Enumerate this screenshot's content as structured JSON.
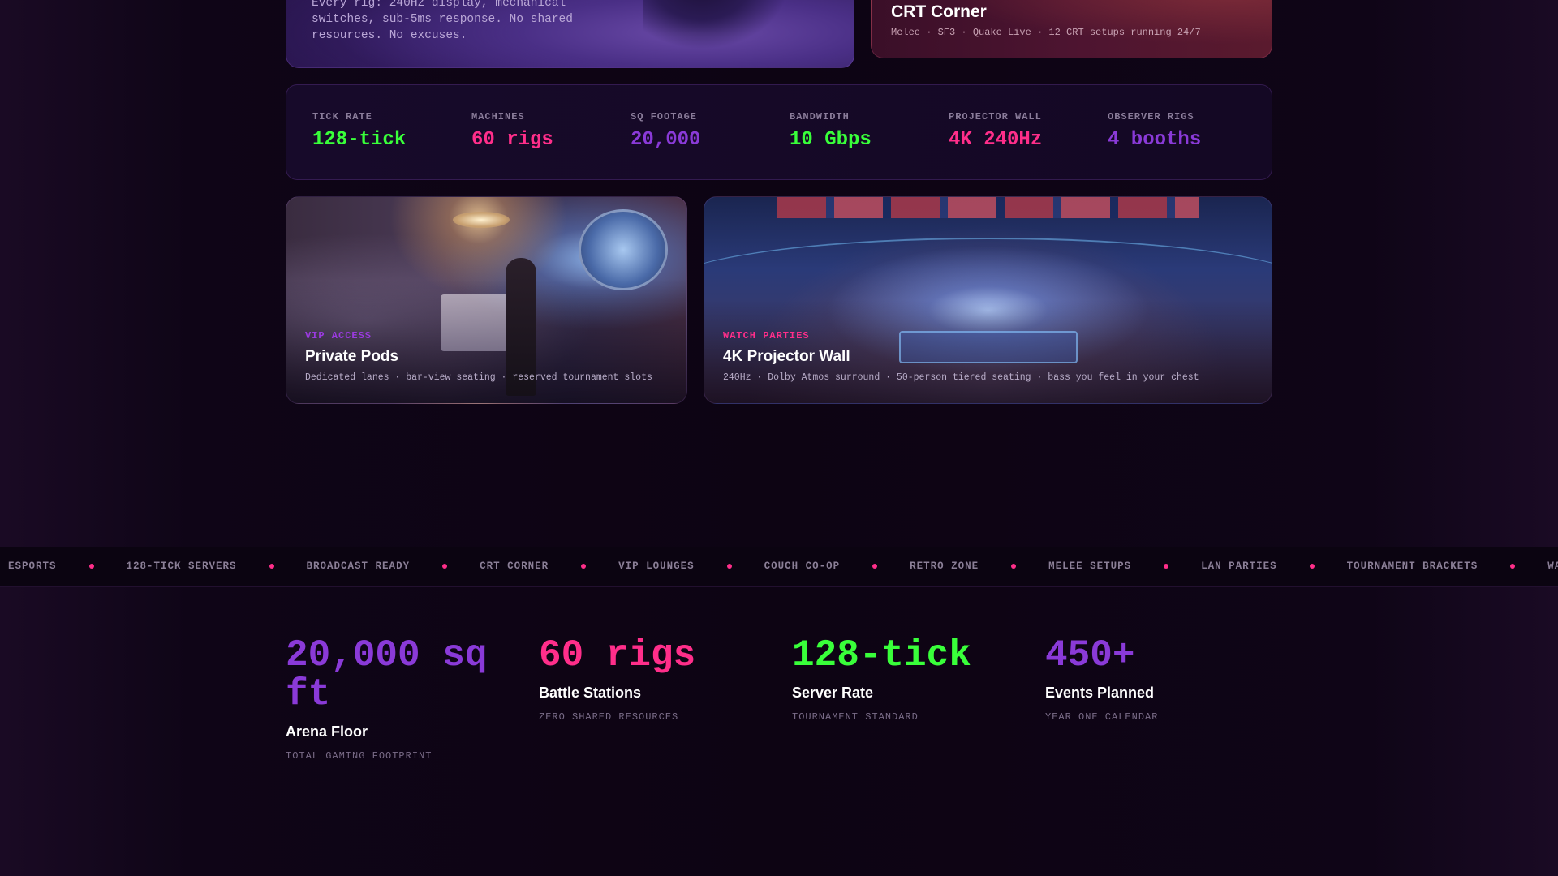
{
  "top_cards": {
    "left_text": "Every rig: 240Hz display, mechanical switches, sub-5ms response. No shared resources. No excuses.",
    "right_title": "CRT Corner",
    "right_desc": "Melee · SF3 · Quake Live · 12 CRT setups running 24/7"
  },
  "stats": [
    {
      "label": "TICK RATE",
      "value": "128-tick",
      "color": "#39ff3a"
    },
    {
      "label": "MACHINES",
      "value": "60 rigs",
      "color": "#ff2e8a"
    },
    {
      "label": "SQ FOOTAGE",
      "value": "20,000",
      "color": "#8a3ad8"
    },
    {
      "label": "BANDWIDTH",
      "value": "10 Gbps",
      "color": "#39ff3a"
    },
    {
      "label": "PROJECTOR WALL",
      "value": "4K 240Hz",
      "color": "#ff2e8a"
    },
    {
      "label": "OBSERVER RIGS",
      "value": "4 booths",
      "color": "#8a3ad8"
    }
  ],
  "features": {
    "pods": {
      "tag": "VIP ACCESS",
      "tag_color": "#9b3ae0",
      "title": "Private Pods",
      "desc": "Dedicated lanes · bar-view seating · reserved tournament slots"
    },
    "wall": {
      "tag": "WATCH PARTIES",
      "tag_color": "#ff2e8a",
      "title": "4K Projector Wall",
      "desc": "240Hz · Dolby Atmos surround · 50-person tiered seating · bass you feel in your chest"
    }
  },
  "ticker": [
    "ESPORTS",
    "128-TICK SERVERS",
    "BROADCAST READY",
    "CRT CORNER",
    "VIP LOUNGES",
    "COUCH CO-OP",
    "RETRO ZONE",
    "MELEE SETUPS",
    "LAN PARTIES",
    "TOURNAMENT BRACKETS",
    "WATCH PARTIES"
  ],
  "big_stats": [
    {
      "number": "20,000 sq ft",
      "title": "Arena Floor",
      "sub": "TOTAL GAMING FOOTPRINT",
      "color": "#8a3ad8"
    },
    {
      "number": "60 rigs",
      "title": "Battle Stations",
      "sub": "ZERO SHARED RESOURCES",
      "color": "#ff2e8a"
    },
    {
      "number": "128-tick",
      "title": "Server Rate",
      "sub": "TOURNAMENT STANDARD",
      "color": "#39ff3a"
    },
    {
      "number": "450+",
      "title": "Events Planned",
      "sub": "YEAR ONE CALENDAR",
      "color": "#8a3ad8"
    }
  ]
}
